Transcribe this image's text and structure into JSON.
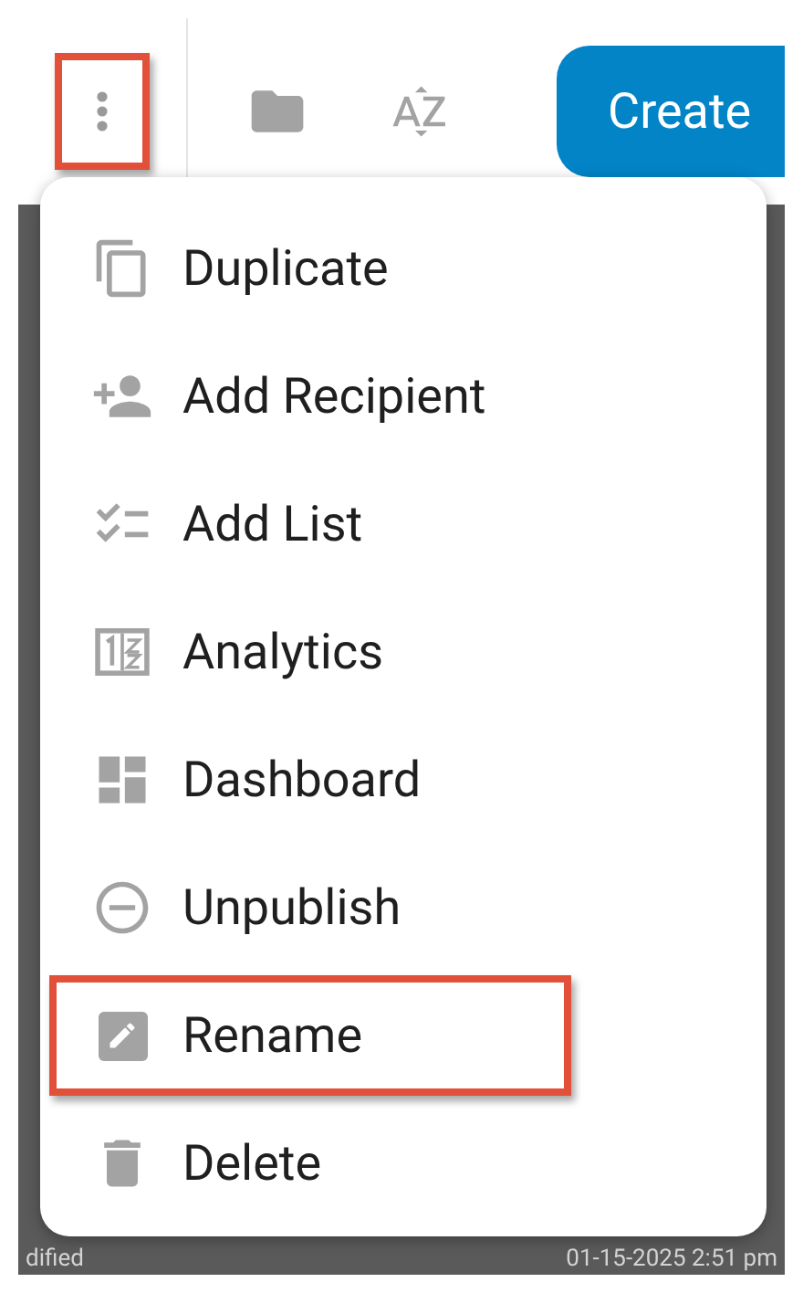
{
  "toolbar": {
    "more_button": {
      "highlighted": true
    },
    "create_button": {
      "label": "Create"
    }
  },
  "menu": {
    "items": [
      {
        "kind": "duplicate",
        "label": "Duplicate",
        "highlighted": false
      },
      {
        "kind": "add-recipient",
        "label": "Add Recipient",
        "highlighted": false
      },
      {
        "kind": "add-list",
        "label": "Add List",
        "highlighted": false
      },
      {
        "kind": "analytics",
        "label": "Analytics",
        "highlighted": false
      },
      {
        "kind": "dashboard",
        "label": "Dashboard",
        "highlighted": false
      },
      {
        "kind": "unpublish",
        "label": "Unpublish",
        "highlighted": false
      },
      {
        "kind": "rename",
        "label": "Rename",
        "highlighted": true
      },
      {
        "kind": "delete",
        "label": "Delete",
        "highlighted": false
      }
    ]
  },
  "background_row": {
    "label": "dified",
    "value": "01-15-2025 2:51 pm"
  }
}
